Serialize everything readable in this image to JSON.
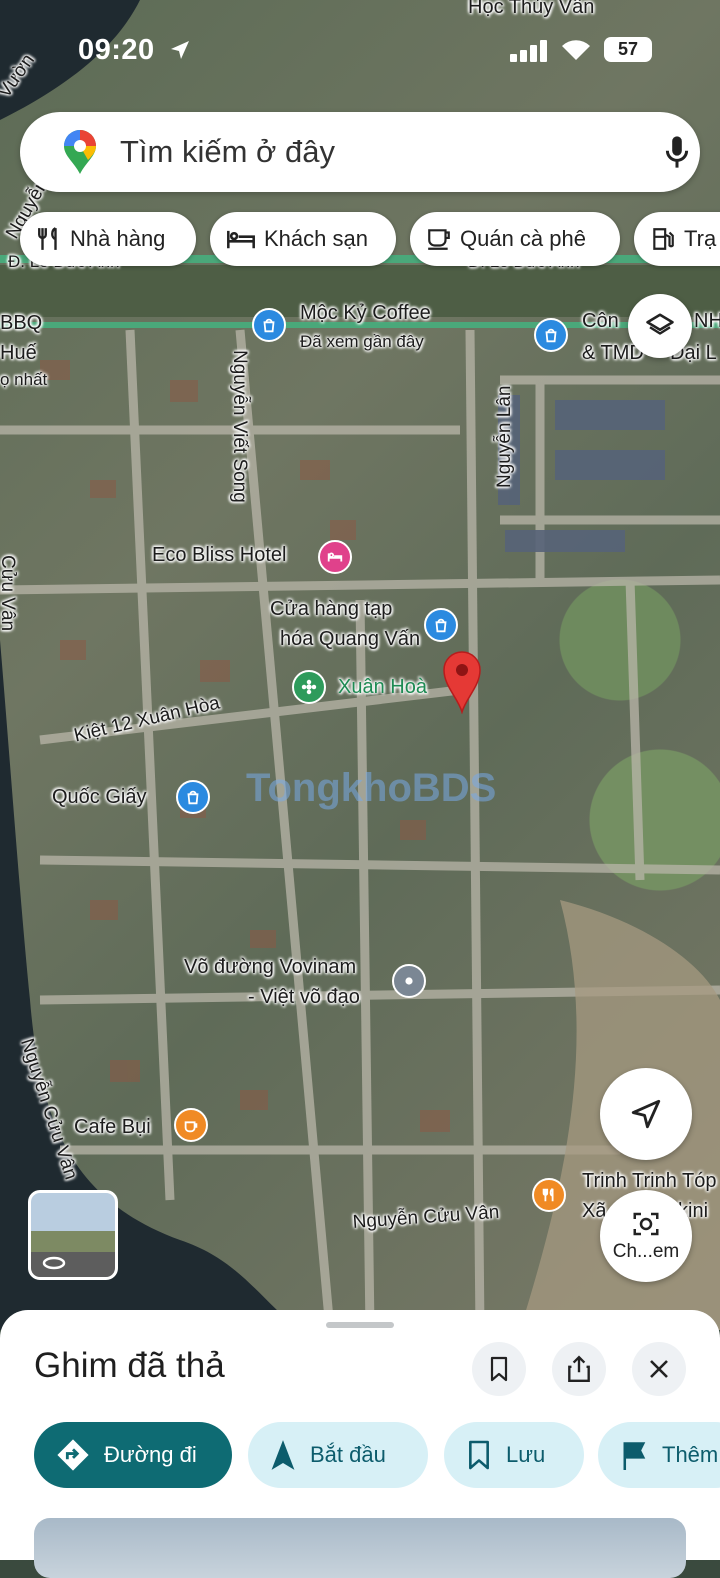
{
  "status_bar": {
    "time": "09:20",
    "battery": "57"
  },
  "search": {
    "placeholder": "Tìm kiếm ở đây"
  },
  "chips": [
    {
      "label": "Nhà hàng",
      "icon": "restaurant-icon"
    },
    {
      "label": "Khách sạn",
      "icon": "hotel-icon"
    },
    {
      "label": "Quán cà phê",
      "icon": "coffee-icon"
    },
    {
      "label": "Trạ",
      "icon": "gas-station-icon"
    }
  ],
  "map": {
    "top_label": "Học Thủy Vân",
    "streets": {
      "le_duc_anh_left": "Đ. Lê Đức Anh",
      "le_duc_anh_right": "Đ. Lê Đức Anh",
      "nguyen_vuon": "Vườn",
      "nguyen_vert": "Nguyễn",
      "nguyen_viet_song": "Nguyễn Viết Song",
      "nguyen_lan": "Nguyễn Lân",
      "kiet12": "Kiệt 12 Xuân Hòa",
      "cuu_van_left_top": "Cửu Vân",
      "nguyen_cuu_van_left": "Nguyễn Cửu Vân",
      "nguyen_cuu_van_bottom": "Nguyễn Cửu Vân"
    },
    "pois": {
      "bbq": "BBQ",
      "hue": "Huế",
      "nhat": "ọ nhất",
      "moc_ky": "Mộc Kỷ Coffee",
      "moc_ky_sub": "Đã xem gần đây",
      "cong": "Côn",
      "nhi": "NHI",
      "tmdv": "& TMD",
      "dai": "Đại L",
      "eco_bliss": "Eco Bliss Hotel",
      "cua_hang_1": "Cửa hàng tạp",
      "cua_hang_2": "hóa Quang Vấn",
      "xuan_hoa": "Xuân Hoà",
      "quoc_giay": "Quốc Giấy",
      "vovinam_1": "Võ đường Vovinam",
      "vovinam_2": "- Việt võ đạo",
      "cafe_bui": "Cafe Bụi",
      "trinh_1": "Trinh Trinh Tóp",
      "trinh_2": "Xã",
      "trinh_3": "kini"
    },
    "watermark": "TongkhoBDS",
    "camera_label": "Ch...em"
  },
  "sheet": {
    "title": "Ghim đã thả",
    "actions": [
      {
        "label": "Đường đi",
        "icon": "directions-icon"
      },
      {
        "label": "Bắt đầu",
        "icon": "navigation-arrow-icon"
      },
      {
        "label": "Lưu",
        "icon": "bookmark-icon"
      },
      {
        "label": "Thêm",
        "icon": "flag-icon"
      }
    ]
  },
  "colors": {
    "accent": "#0e6b73",
    "pin_red": "#e53935",
    "poi_blue": "#2b8ae0",
    "hotel_pink": "#e0418b",
    "park_green": "#2e9b5b",
    "cafe_orange": "#f08a24"
  }
}
